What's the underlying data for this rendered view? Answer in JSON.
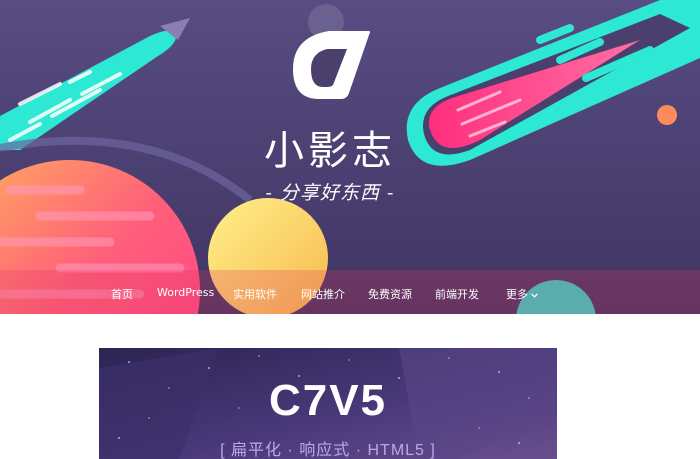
{
  "header": {
    "site_title": "小影志",
    "tagline": "- 分享好东西 -"
  },
  "nav": {
    "items": [
      "首页",
      "WordPress",
      "实用软件",
      "网站推介",
      "免费资源",
      "前端开发"
    ],
    "more_label": "更多"
  },
  "banner": {
    "title": "C7V5",
    "subtitle": "[ 扁平化 · 响应式 · HTML5 ]"
  },
  "colors": {
    "hero_bg": "#4a3f6d",
    "cyan": "#2de8d2",
    "pink": "#ff3f8a",
    "yellow": "#f6d96a",
    "orange": "#ff8a5c"
  }
}
